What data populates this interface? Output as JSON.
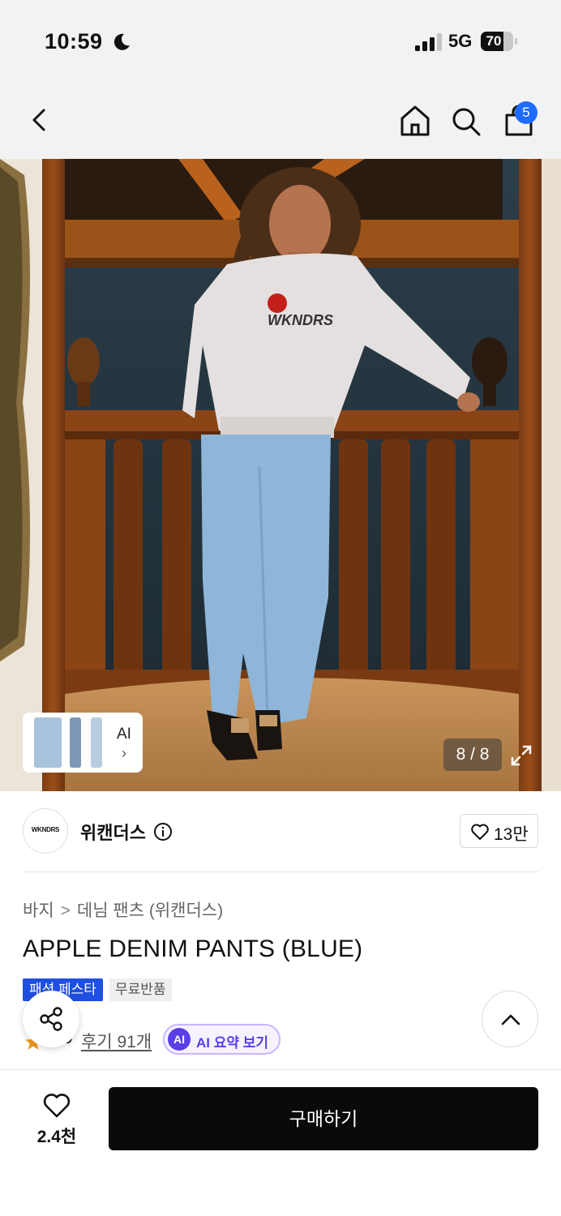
{
  "status_bar": {
    "time": "10:59",
    "network": "5G",
    "battery": "70",
    "battery_level": 0.7,
    "icons": [
      "moon-icon",
      "signal-icon",
      "battery-icon"
    ]
  },
  "header": {
    "cart_count": "5",
    "icons": [
      "back-icon",
      "home-icon",
      "search-icon",
      "shopping-bag-icon"
    ]
  },
  "gallery": {
    "thumbnail_label": "AI",
    "thumbnail_chevron": "›",
    "counter": "8 / 8"
  },
  "brand": {
    "logo_text": "WKNDRS",
    "name": "위캔더스",
    "likes": "13만"
  },
  "product": {
    "breadcrumb": [
      "바지",
      "데님 팬츠 (위캔더스)"
    ],
    "breadcrumb_separator": ">",
    "title": "APPLE DENIM PANTS (BLUE)",
    "tags": [
      "패션 페스타",
      "무료반품"
    ],
    "rating_partial": "9",
    "reviews": "후기 91개",
    "ai_badge": "AI",
    "ai_summary": "AI 요약 보기"
  },
  "bottom_bar": {
    "wishlist_count": "2.4천",
    "buy_label": "구매하기"
  },
  "colors": {
    "accent_blue": "#1f4fe0",
    "badge_blue": "#1f6bff",
    "ai_purple": "#5b3ee6",
    "buy_black": "#0a0a0a",
    "star_orange": "#f29a1f"
  }
}
